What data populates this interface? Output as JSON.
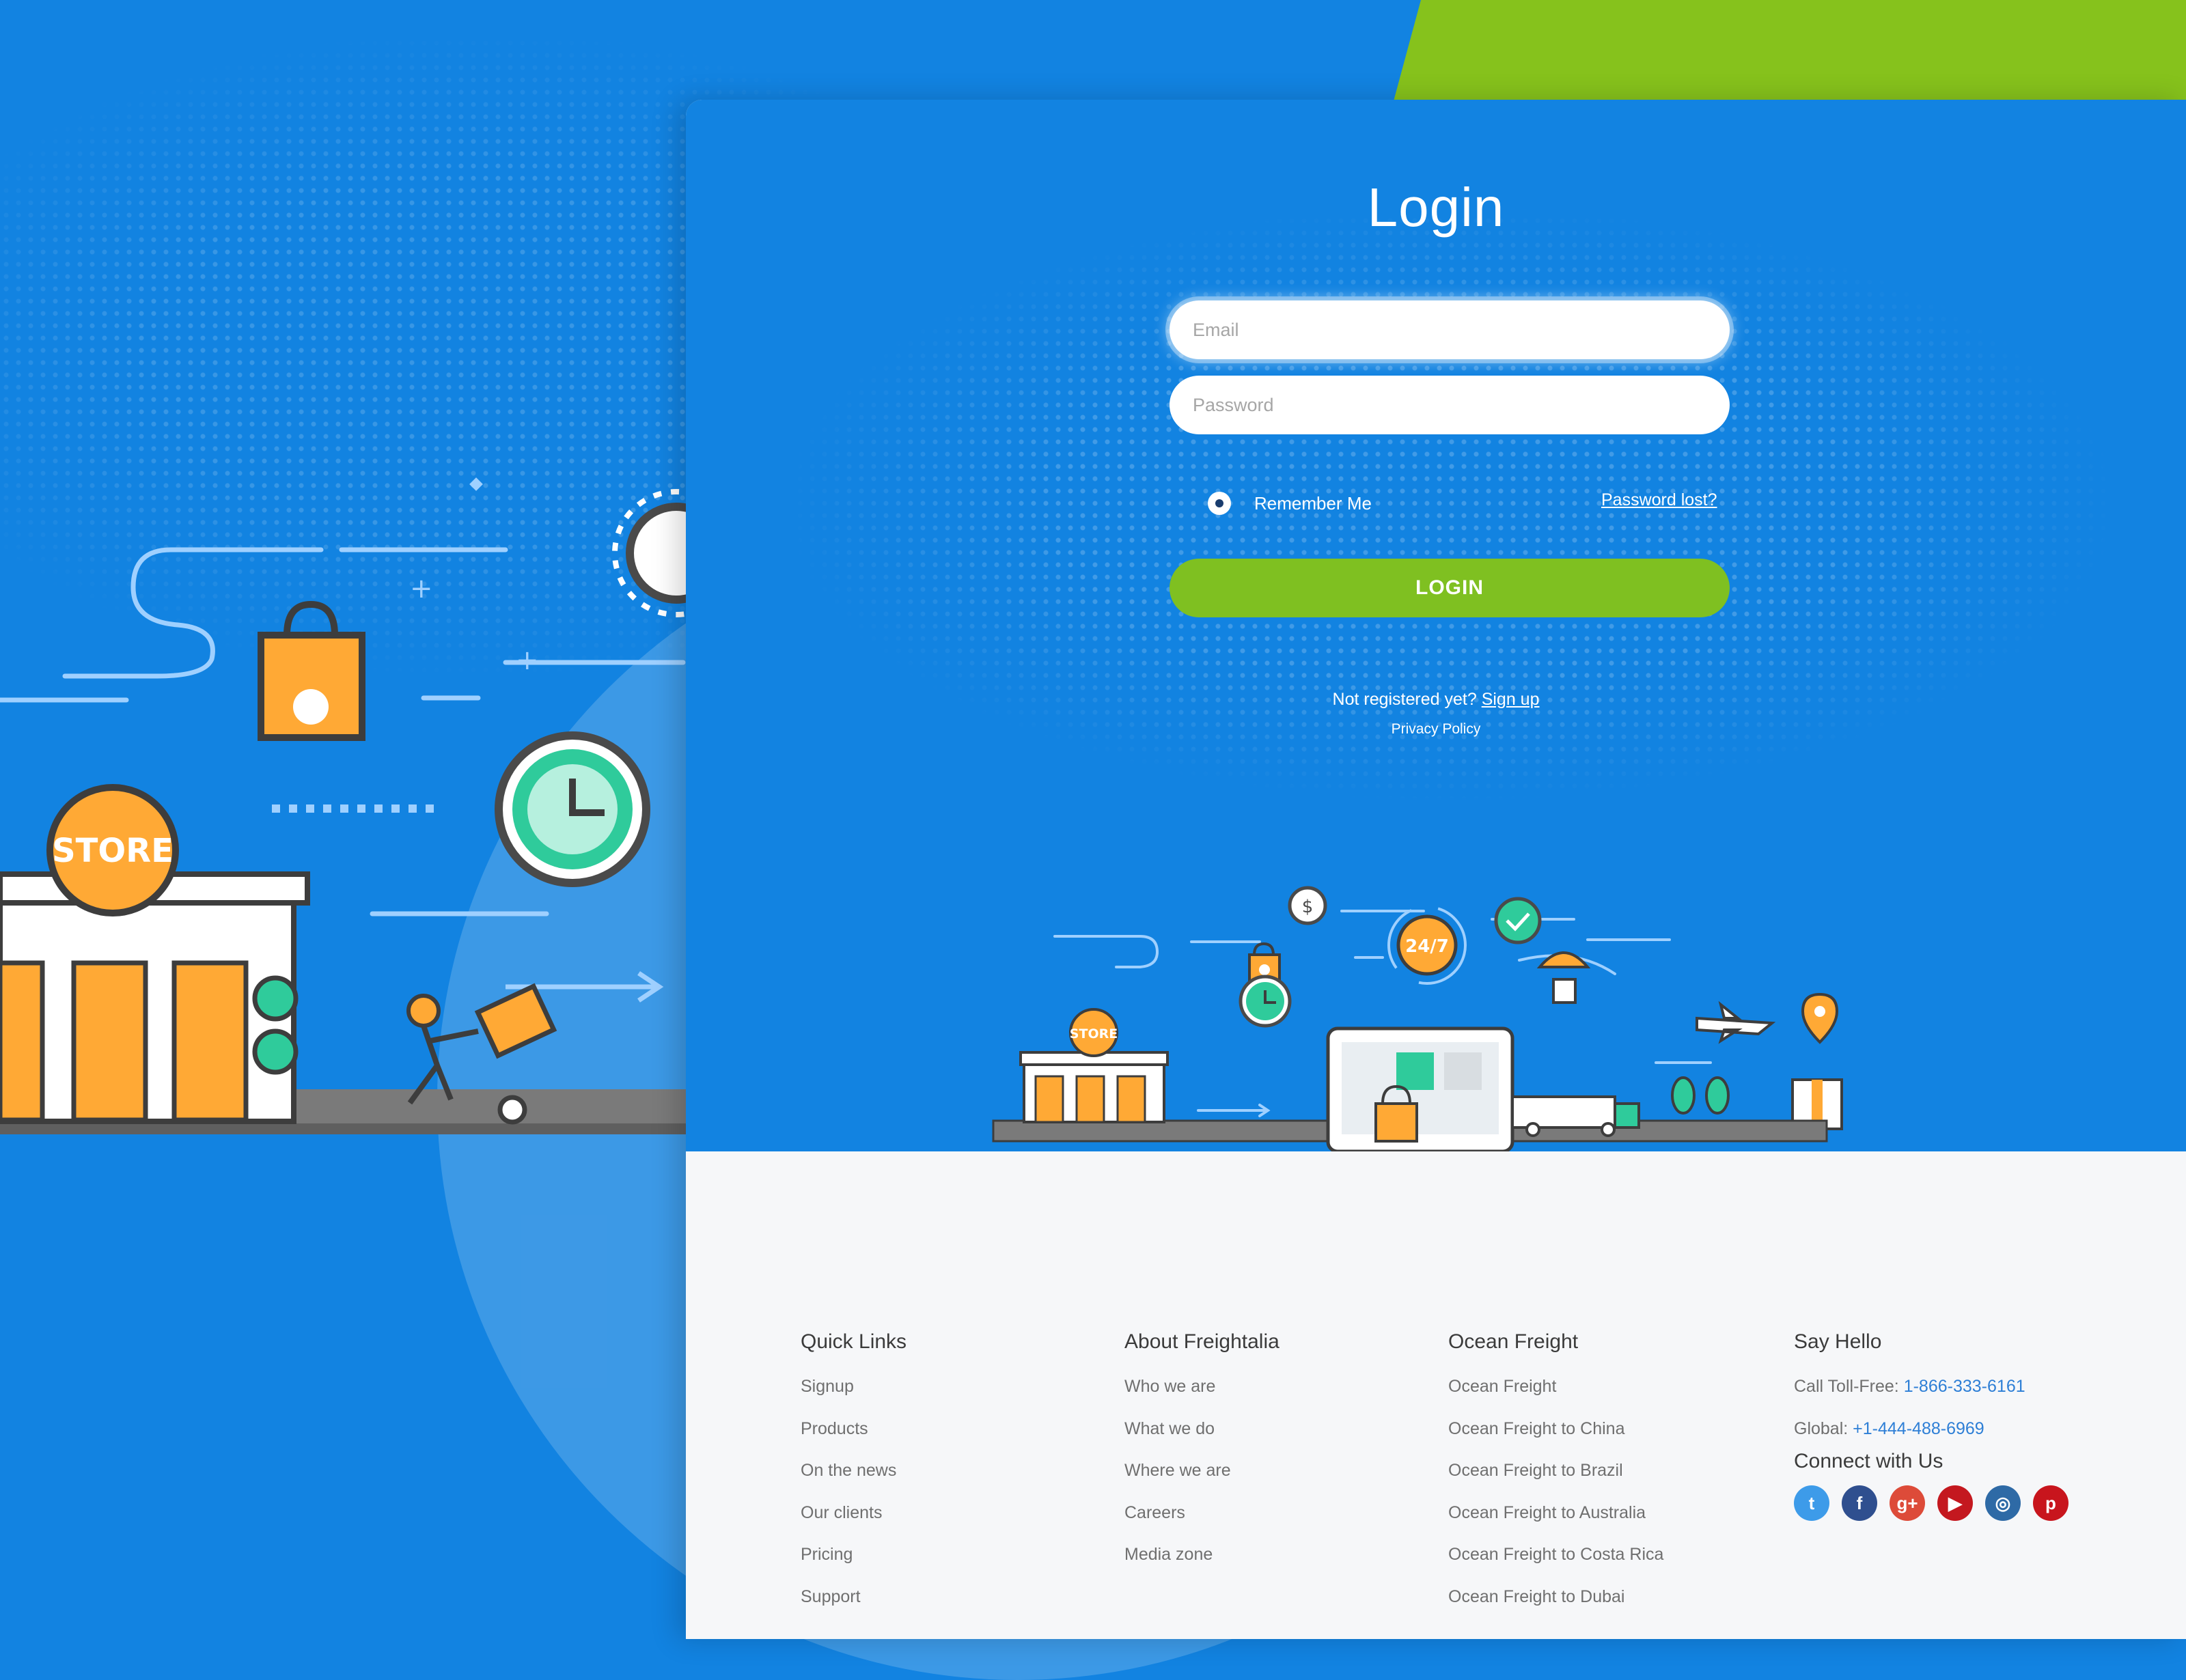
{
  "login": {
    "title": "Login",
    "email_placeholder": "Email",
    "password_placeholder": "Password",
    "remember_label": "Remember Me",
    "password_lost": "Password lost?",
    "button_label": "LOGIN",
    "not_registered": "Not registered yet?",
    "signup_link": "Sign up",
    "privacy_policy": "Privacy Policy"
  },
  "illustration": {
    "store_sign": "STORE",
    "badge_247": "24/7"
  },
  "footer": {
    "quick_links": {
      "heading": "Quick Links",
      "items": [
        "Signup",
        "Products",
        "On the news",
        "Our clients",
        "Pricing",
        "Support"
      ]
    },
    "about": {
      "heading": "About Freightalia",
      "items": [
        "Who we are",
        "What we do",
        "Where we are",
        "Careers",
        "Media zone"
      ]
    },
    "ocean": {
      "heading": "Ocean Freight",
      "items": [
        "Ocean Freight",
        "Ocean Freight to China",
        "Ocean Freight to Brazil",
        "Ocean Freight to Australia",
        "Ocean Freight to Costa Rica",
        "Ocean Freight to Dubai"
      ]
    },
    "hello": {
      "heading": "Say Hello",
      "toll_free_label": "Call Toll-Free:",
      "toll_free_number": "1-866-333-6161",
      "global_label": "Global:",
      "global_number": "+1-444-488-6969",
      "connect_heading": "Connect with Us",
      "social": [
        {
          "icon": "twitter-icon",
          "glyph": "t",
          "color": "#3d9be9"
        },
        {
          "icon": "facebook-icon",
          "glyph": "f",
          "color": "#2f4f8f"
        },
        {
          "icon": "google-plus-icon",
          "glyph": "g+",
          "color": "#dd4b39"
        },
        {
          "icon": "youtube-icon",
          "glyph": "▶",
          "color": "#c4181f"
        },
        {
          "icon": "instagram-icon",
          "glyph": "◎",
          "color": "#2e6aa6"
        },
        {
          "icon": "pinterest-icon",
          "glyph": "p",
          "color": "#c8151d"
        }
      ]
    }
  },
  "colors": {
    "brand_blue": "#1283e1",
    "accent_green": "#7fc021",
    "illustration_orange": "#ffa935",
    "illustration_teal": "#2fcb9b"
  }
}
